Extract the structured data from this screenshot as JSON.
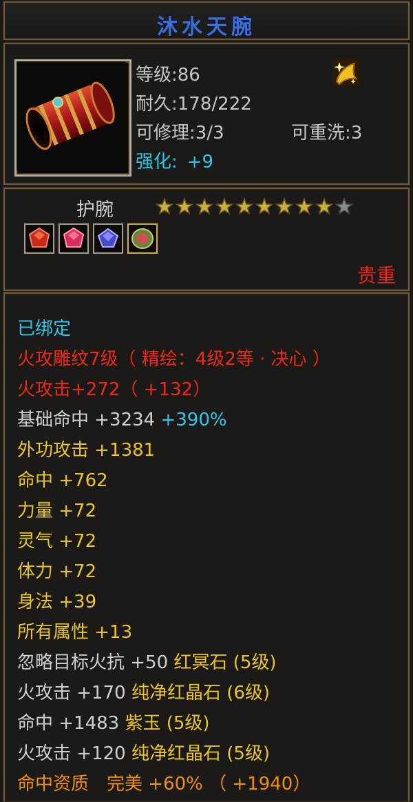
{
  "title": "沐水天腕",
  "header": {
    "level_label": "等级:",
    "level_value": "86",
    "durability_label": "耐久:",
    "durability_value": "178/222",
    "repair_label": "可修理:",
    "repair_value": "3/3",
    "rewash_label": "可重洗:",
    "rewash_value": "3",
    "enhance_label": "强化:",
    "enhance_value": "+9",
    "item_icon": "bracer-icon",
    "badge_icon": "gold-sparkle-badge-icon"
  },
  "type_section": {
    "type_label": "护腕",
    "stars_total": 10,
    "stars_filled": 9,
    "gems": [
      {
        "icon": "red-gem-icon",
        "color": "#d83a2a"
      },
      {
        "icon": "pink-gem-icon",
        "color": "#e0406a"
      },
      {
        "icon": "blue-purple-gem-icon",
        "color": "#6a6adc"
      },
      {
        "icon": "green-red-gem-icon",
        "color": "#c85a5a"
      }
    ],
    "rarity": "贵重"
  },
  "attributes": {
    "bound": "已绑定",
    "engraving": "火攻雕纹7级（ 精绘：4级2等 · 决心 ）",
    "fire_attack": "火攻击+272（ +132）",
    "base_hit_label": "基础命中 +3234",
    "base_hit_bonus": "+390%",
    "lines": [
      "外功攻击 +1381",
      "命中 +762",
      "力量 +72",
      "灵气 +72",
      "体力 +72",
      "身法 +39",
      "所有属性 +13"
    ],
    "gem_lines": [
      {
        "stat": "忽略目标火抗 +50",
        "gem": "红冥石 (5级)"
      },
      {
        "stat": "火攻击 +170",
        "gem": "纯净红晶石 (6级)"
      },
      {
        "stat": "命中 +1483",
        "gem": "紫玉 (5级)"
      },
      {
        "stat": "火攻击 +120",
        "gem": "纯净红晶石 (5级)"
      }
    ],
    "aptitude": "命中资质　完美 +60% （ +1940）"
  },
  "colors": {
    "title": "#3a6fd8",
    "enhance": "#25c8e0",
    "rarity": "#e8261c",
    "engraving": "#ec2a1c",
    "stat": "#e8c528",
    "aptitude": "#f0900e",
    "star_filled": "#c8b040",
    "star_empty": "#8a8a8a"
  }
}
